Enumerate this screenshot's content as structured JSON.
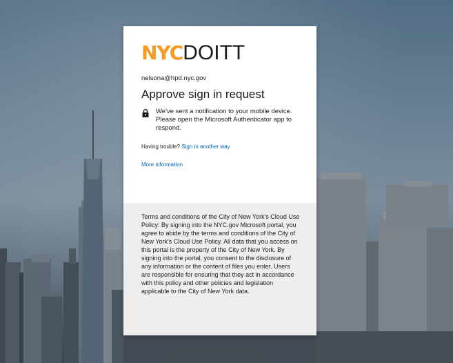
{
  "brand": {
    "logo_nyc": "NYC",
    "logo_doitt": "DOITT",
    "accent": "#f59a23"
  },
  "account": {
    "email": "nelsona@hpd.nyc.gov"
  },
  "heading": {
    "title": "Approve sign in request"
  },
  "notice": {
    "icon": "lock-icon",
    "text": "We've sent a notification to your mobile device. Please open the Microsoft Authenticator app to respond."
  },
  "help": {
    "prefix": "Having trouble?",
    "link": "Sign in another way",
    "more": "More information"
  },
  "terms": {
    "text": "Terms and conditions of the City of New York's Cloud Use Policy: By signing into the NYC.gov Microsoft portal, you agree to abide by the terms and conditions of the City of New York's Cloud Use Policy. All data that you access on this portal is the property of the City of New York. By signing into the portal, you consent to the disclosure of any information or the content of files you enter. Users are responsible for ensuring that they act in accordance with this policy and other policies and legislation applicable to the City of New York data."
  },
  "colors": {
    "link": "#0067b8",
    "footer_bg": "#eeeeee"
  }
}
